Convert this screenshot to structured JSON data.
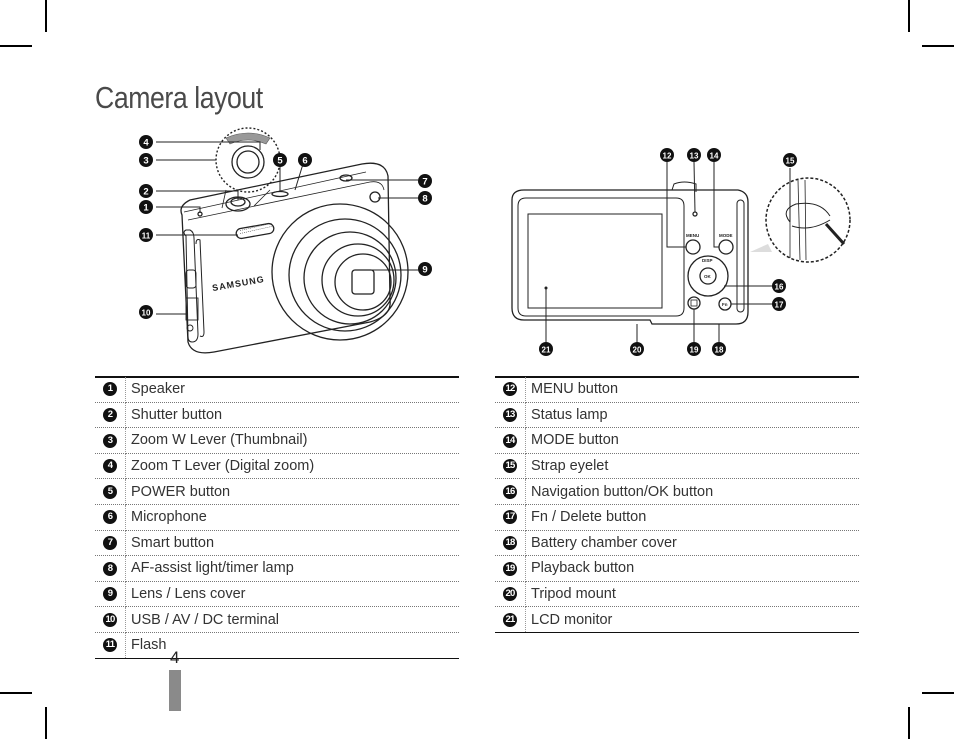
{
  "page": {
    "title": "Camera layout",
    "page_number": "4"
  },
  "front_view": {
    "brand_label": "SAMSUNG",
    "callouts": [
      "1",
      "2",
      "3",
      "4",
      "5",
      "6",
      "7",
      "8",
      "9",
      "10",
      "11"
    ]
  },
  "back_view": {
    "button_labels": {
      "menu": "MENU",
      "mode": "MODE",
      "disp": "DISP",
      "ok": "OK",
      "fn": "Fn"
    },
    "callouts": [
      "12",
      "13",
      "14",
      "15",
      "16",
      "17",
      "18",
      "19",
      "20",
      "21"
    ]
  },
  "left_table": {
    "rows": [
      {
        "num": "1",
        "label": "Speaker"
      },
      {
        "num": "2",
        "label": "Shutter button"
      },
      {
        "num": "3",
        "label": "Zoom W Lever (Thumbnail)"
      },
      {
        "num": "4",
        "label": "Zoom T Lever (Digital zoom)"
      },
      {
        "num": "5",
        "label": "POWER button"
      },
      {
        "num": "6",
        "label": "Microphone"
      },
      {
        "num": "7",
        "label": "Smart button"
      },
      {
        "num": "8",
        "label": "AF-assist light/timer lamp"
      },
      {
        "num": "9",
        "label": "Lens / Lens cover"
      },
      {
        "num": "10",
        "label": "USB / AV / DC terminal"
      },
      {
        "num": "11",
        "label": "Flash"
      }
    ]
  },
  "right_table": {
    "rows": [
      {
        "num": "12",
        "label": "MENU button"
      },
      {
        "num": "13",
        "label": "Status lamp"
      },
      {
        "num": "14",
        "label": "MODE button"
      },
      {
        "num": "15",
        "label": "Strap eyelet"
      },
      {
        "num": "16",
        "label": "Navigation button/OK button"
      },
      {
        "num": "17",
        "label": "Fn / Delete button"
      },
      {
        "num": "18",
        "label": "Battery chamber cover"
      },
      {
        "num": "19",
        "label": "Playback button"
      },
      {
        "num": "20",
        "label": "Tripod mount"
      },
      {
        "num": "21",
        "label": "LCD monitor"
      }
    ]
  }
}
